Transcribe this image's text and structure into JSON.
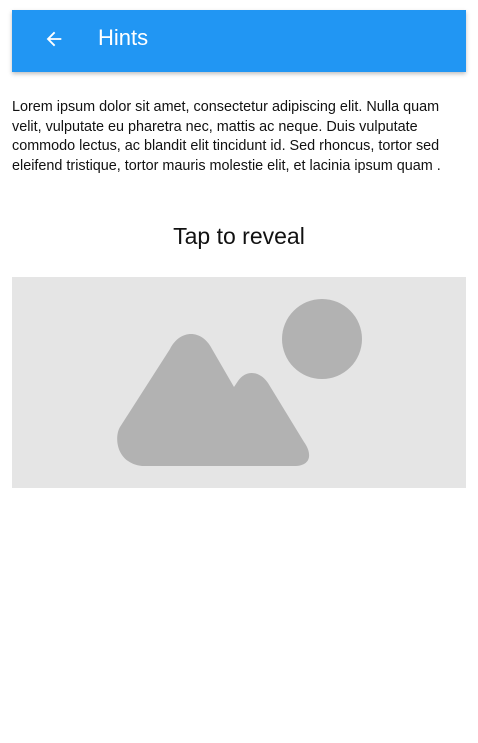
{
  "app_bar": {
    "title": "Hints",
    "back_icon": "arrow-left-icon",
    "background_color": "#2196F3"
  },
  "content": {
    "paragraph": "Lorem ipsum dolor sit amet, consectetur adipiscing elit. Nulla quam velit, vulputate eu pharetra nec, mattis ac neque. Duis vulputate commodo lectus, ac blandit elit tincidunt id. Sed rhoncus, tortor sed eleifend tristique, tortor mauris molestie elit, et lacinia ipsum quam .",
    "reveal_label": "Tap to reveal",
    "image_icon": "image-placeholder-icon",
    "placeholder_color": "#e5e5e5",
    "icon_color": "#b2b2b2"
  }
}
